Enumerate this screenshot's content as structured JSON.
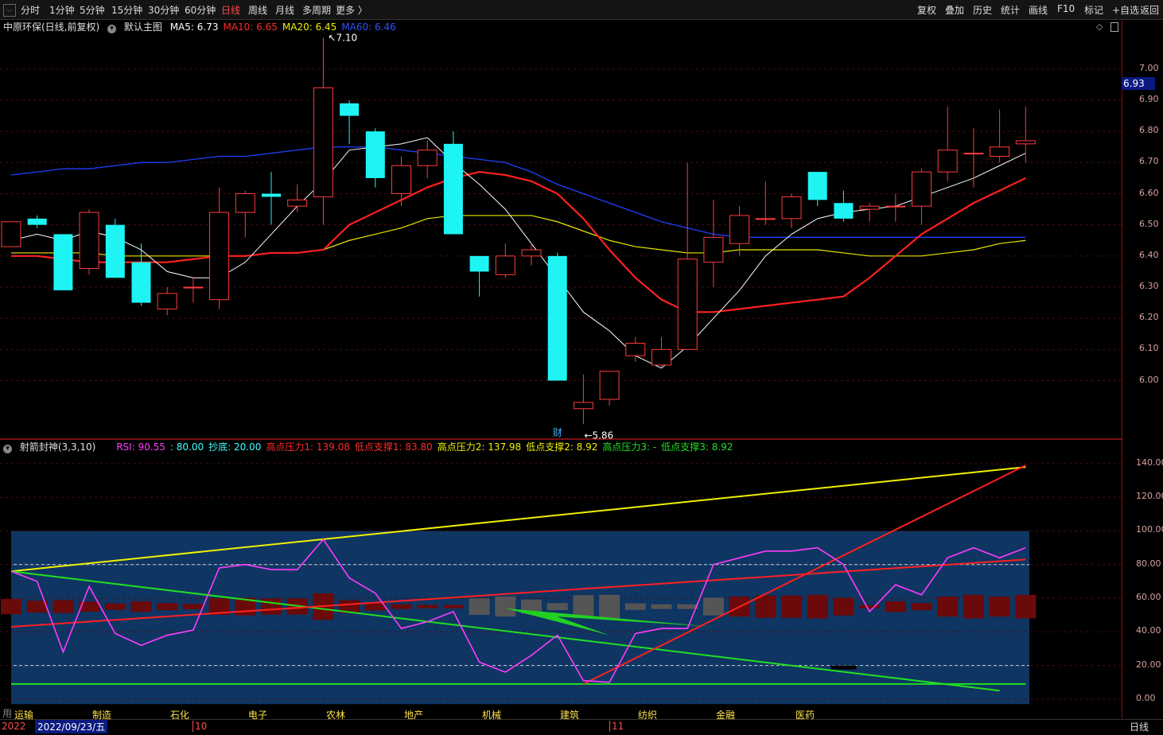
{
  "toolbar": {
    "corner_icon": "window-menu-icon",
    "periods": [
      "分时",
      "1分钟",
      "5分钟",
      "15分钟",
      "30分钟",
      "60分钟",
      "日线",
      "周线",
      "月线",
      "多周期",
      "更多 〉"
    ],
    "active_period": "日线",
    "right_buttons": [
      "复权",
      "叠加",
      "历史",
      "统计",
      "画线",
      "F10",
      "标记",
      "+自选",
      "返回"
    ]
  },
  "main_panel": {
    "title": "中原环保(日线,前复权)",
    "template": "默认主图",
    "ma": [
      {
        "label": "MA5: 6.73",
        "color": "#ffffff"
      },
      {
        "label": "MA10: 6.65",
        "color": "#ff2a2a"
      },
      {
        "label": "MA20: 6.45",
        "color": "#f0f000"
      },
      {
        "label": "MA60: 6.46",
        "color": "#3050ff"
      }
    ],
    "high_mark": "7.10",
    "low_mark": "5.86",
    "current_price": "6.93",
    "event_tag": "财",
    "y_ticks": [
      "7.00",
      "6.90",
      "6.80",
      "6.70",
      "6.60",
      "6.50",
      "6.40",
      "6.30",
      "6.20",
      "6.10",
      "6.00"
    ]
  },
  "sub_panel": {
    "title": "射箭封神(3,3,10)",
    "legend": [
      {
        "label": "RSI: 90.55",
        "color": "#ff3cff"
      },
      {
        "label": ": 80.00",
        "color": "#40ffff"
      },
      {
        "label": "抄底: 20.00",
        "color": "#40ffff"
      },
      {
        "label": "高点压力1: 139.08",
        "color": "#ff2a2a"
      },
      {
        "label": "低点支撑1: 83.80",
        "color": "#ff2a2a"
      },
      {
        "label": "高点压力2: 137.98",
        "color": "#f0f000"
      },
      {
        "label": "低点支撑2: 8.92",
        "color": "#f0f000"
      },
      {
        "label": "高点压力3: -",
        "color": "#20e020"
      },
      {
        "label": "低点支撑3: 8.92",
        "color": "#20e020"
      }
    ],
    "y_ticks": [
      "140.00",
      "120.00",
      "100.00",
      "80.00",
      "60.00",
      "40.00",
      "20.00",
      "0.00"
    ],
    "sectors": [
      "运输",
      "制造",
      "石化",
      "电子",
      "农林",
      "地产",
      "机械",
      "建筑",
      "纺织",
      "金融",
      "医药"
    ]
  },
  "bottom_bar": {
    "year_prefix": "2022",
    "date_label": "2022/09/23/五",
    "month_1": "10",
    "month_2": "11",
    "period_button": "日线",
    "corner_char": "用"
  },
  "chart_data": {
    "type": "candlestick",
    "candles": [
      {
        "o": 6.43,
        "h": 6.51,
        "l": 6.43,
        "c": 6.51
      },
      {
        "o": 6.52,
        "h": 6.53,
        "l": 6.49,
        "c": 6.5
      },
      {
        "o": 6.47,
        "h": 6.47,
        "l": 6.29,
        "c": 6.29
      },
      {
        "o": 6.36,
        "h": 6.55,
        "l": 6.34,
        "c": 6.54
      },
      {
        "o": 6.5,
        "h": 6.52,
        "l": 6.34,
        "c": 6.33
      },
      {
        "o": 6.38,
        "h": 6.44,
        "l": 6.24,
        "c": 6.25
      },
      {
        "o": 6.23,
        "h": 6.3,
        "l": 6.21,
        "c": 6.28
      },
      {
        "o": 6.3,
        "h": 6.33,
        "l": 6.25,
        "c": 6.3
      },
      {
        "o": 6.26,
        "h": 6.62,
        "l": 6.23,
        "c": 6.54
      },
      {
        "o": 6.54,
        "h": 6.61,
        "l": 6.46,
        "c": 6.6
      },
      {
        "o": 6.6,
        "h": 6.67,
        "l": 6.5,
        "c": 6.59
      },
      {
        "o": 6.56,
        "h": 6.63,
        "l": 6.54,
        "c": 6.58
      },
      {
        "o": 6.59,
        "h": 7.1,
        "l": 6.5,
        "c": 6.94
      },
      {
        "o": 6.89,
        "h": 6.9,
        "l": 6.76,
        "c": 6.85
      },
      {
        "o": 6.8,
        "h": 6.81,
        "l": 6.62,
        "c": 6.65
      },
      {
        "o": 6.6,
        "h": 6.72,
        "l": 6.56,
        "c": 6.69
      },
      {
        "o": 6.69,
        "h": 6.77,
        "l": 6.65,
        "c": 6.74
      },
      {
        "o": 6.76,
        "h": 6.8,
        "l": 6.47,
        "c": 6.47
      },
      {
        "o": 6.4,
        "h": 6.4,
        "l": 6.27,
        "c": 6.35
      },
      {
        "o": 6.34,
        "h": 6.44,
        "l": 6.33,
        "c": 6.4
      },
      {
        "o": 6.4,
        "h": 6.44,
        "l": 6.37,
        "c": 6.42
      },
      {
        "o": 6.4,
        "h": 6.41,
        "l": 6.0,
        "c": 6.0
      },
      {
        "o": 5.91,
        "h": 6.02,
        "l": 5.86,
        "c": 5.93
      },
      {
        "o": 5.94,
        "h": 6.03,
        "l": 5.92,
        "c": 6.03
      },
      {
        "o": 6.08,
        "h": 6.14,
        "l": 6.06,
        "c": 6.12
      },
      {
        "o": 6.05,
        "h": 6.14,
        "l": 6.04,
        "c": 6.1
      },
      {
        "o": 6.1,
        "h": 6.7,
        "l": 6.1,
        "c": 6.39
      },
      {
        "o": 6.38,
        "h": 6.58,
        "l": 6.3,
        "c": 6.46
      },
      {
        "o": 6.44,
        "h": 6.56,
        "l": 6.4,
        "c": 6.53
      },
      {
        "o": 6.52,
        "h": 6.64,
        "l": 6.5,
        "c": 6.52
      },
      {
        "o": 6.52,
        "h": 6.6,
        "l": 6.49,
        "c": 6.59
      },
      {
        "o": 6.67,
        "h": 6.67,
        "l": 6.56,
        "c": 6.58
      },
      {
        "o": 6.57,
        "h": 6.61,
        "l": 6.51,
        "c": 6.52
      },
      {
        "o": 6.55,
        "h": 6.57,
        "l": 6.51,
        "c": 6.56
      },
      {
        "o": 6.56,
        "h": 6.6,
        "l": 6.51,
        "c": 6.56
      },
      {
        "o": 6.56,
        "h": 6.68,
        "l": 6.5,
        "c": 6.67
      },
      {
        "o": 6.67,
        "h": 6.88,
        "l": 6.64,
        "c": 6.74
      },
      {
        "o": 6.73,
        "h": 6.81,
        "l": 6.62,
        "c": 6.73
      },
      {
        "o": 6.72,
        "h": 6.87,
        "l": 6.7,
        "c": 6.75
      },
      {
        "o": 6.76,
        "h": 6.88,
        "l": 6.7,
        "c": 6.77
      }
    ],
    "ma5": [
      6.45,
      6.47,
      6.45,
      6.48,
      6.46,
      6.42,
      6.35,
      6.33,
      6.33,
      6.38,
      6.47,
      6.56,
      6.64,
      6.74,
      6.75,
      6.76,
      6.78,
      6.7,
      6.63,
      6.55,
      6.44,
      6.33,
      6.22,
      6.16,
      6.08,
      6.04,
      6.11,
      6.2,
      6.29,
      6.4,
      6.47,
      6.52,
      6.54,
      6.55,
      6.56,
      6.59,
      6.62,
      6.65,
      6.69,
      6.73
    ],
    "ma10": [
      6.4,
      6.4,
      6.39,
      6.38,
      6.38,
      6.38,
      6.38,
      6.39,
      6.4,
      6.4,
      6.41,
      6.41,
      6.42,
      6.5,
      6.54,
      6.58,
      6.62,
      6.65,
      6.67,
      6.66,
      6.64,
      6.6,
      6.52,
      6.42,
      6.33,
      6.26,
      6.22,
      6.22,
      6.23,
      6.24,
      6.25,
      6.26,
      6.27,
      6.33,
      6.4,
      6.47,
      6.52,
      6.57,
      6.61,
      6.65
    ],
    "ma20": [
      6.41,
      6.41,
      6.41,
      6.41,
      6.4,
      6.4,
      6.4,
      6.4,
      6.4,
      6.4,
      6.41,
      6.41,
      6.42,
      6.45,
      6.47,
      6.49,
      6.52,
      6.53,
      6.53,
      6.53,
      6.53,
      6.51,
      6.48,
      6.45,
      6.43,
      6.42,
      6.41,
      6.41,
      6.42,
      6.42,
      6.42,
      6.42,
      6.41,
      6.4,
      6.4,
      6.4,
      6.41,
      6.42,
      6.44,
      6.45
    ],
    "ma60": [
      6.66,
      6.67,
      6.68,
      6.68,
      6.69,
      6.7,
      6.7,
      6.71,
      6.72,
      6.72,
      6.73,
      6.74,
      6.75,
      6.75,
      6.75,
      6.74,
      6.73,
      6.72,
      6.71,
      6.7,
      6.67,
      6.63,
      6.6,
      6.57,
      6.54,
      6.51,
      6.49,
      6.47,
      6.46,
      6.46,
      6.46,
      6.46,
      6.46,
      6.46,
      6.46,
      6.46,
      6.46,
      6.46,
      6.46,
      6.46
    ],
    "rsi": [
      76,
      70,
      28,
      67,
      39,
      32,
      38,
      41,
      78,
      80,
      77,
      77,
      95,
      72,
      63,
      42,
      46,
      52,
      22,
      16,
      26,
      38,
      11,
      10,
      39,
      42,
      42,
      80,
      84,
      88,
      88,
      90,
      80,
      52,
      68,
      62,
      84,
      90,
      84,
      90
    ],
    "rsi_upper": 80,
    "rsi_lower": 20,
    "y_range_price": [
      5.82,
      7.14
    ],
    "y_range_indicator": [
      -10,
      148
    ]
  }
}
